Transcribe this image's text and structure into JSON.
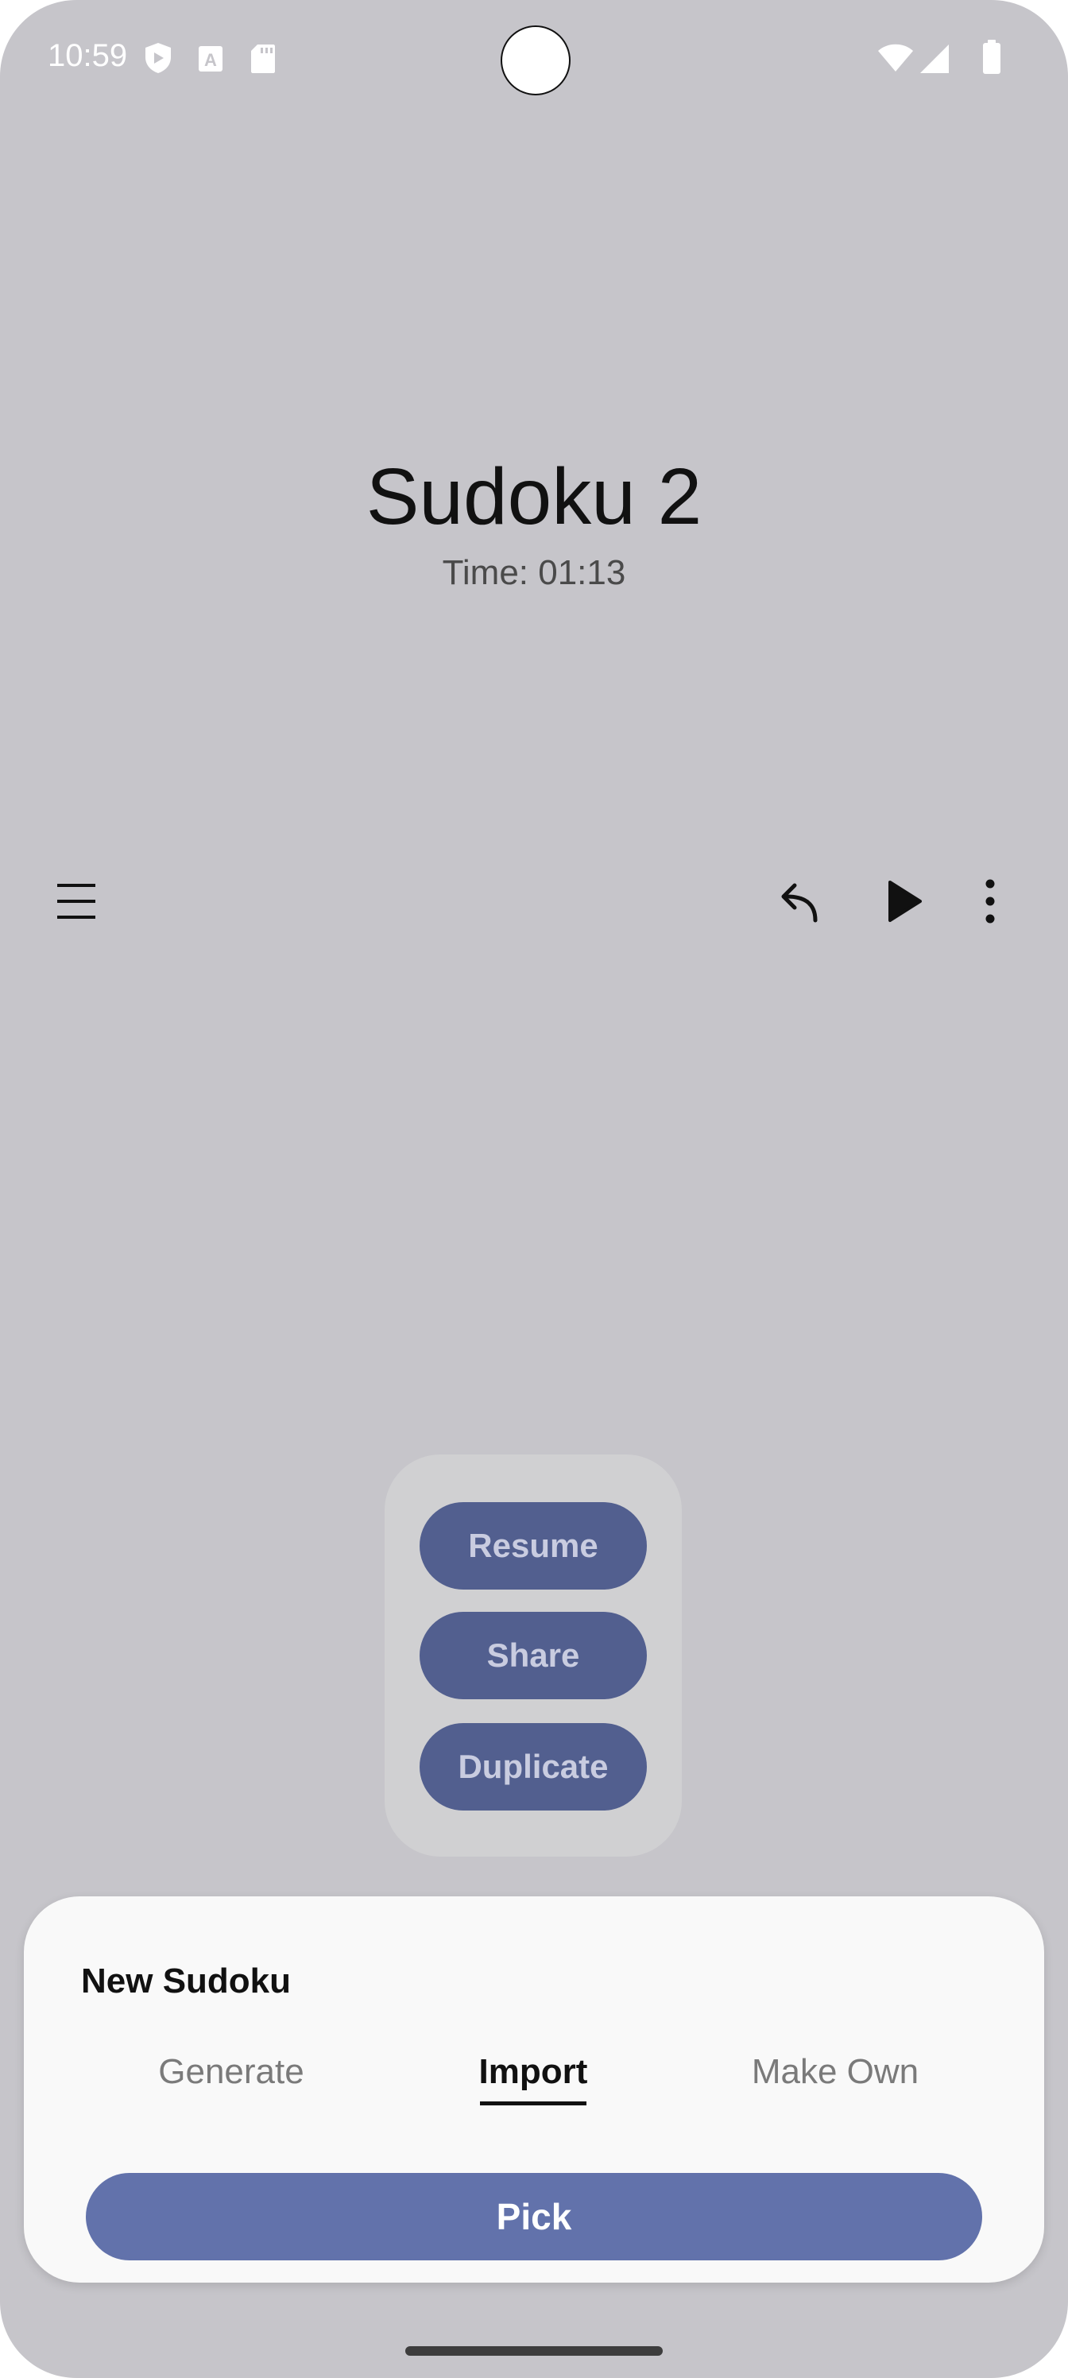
{
  "status_bar": {
    "time": "10:59",
    "icons": [
      "shield-icon",
      "font-a-icon",
      "sd-card-icon",
      "wifi-icon",
      "signal-icon",
      "battery-icon"
    ]
  },
  "header": {
    "title": "Sudoku 2",
    "timer": "Time: 01:13"
  },
  "toolbar": {
    "left_icon": "menu-icon",
    "right_icons": [
      "undo-icon",
      "play-icon",
      "more-vert-icon"
    ]
  },
  "popup_menu": {
    "items": [
      "Resume",
      "Share",
      "Duplicate"
    ],
    "button_color": "#525f8f"
  },
  "bottom_sheet": {
    "title": "New Sudoku",
    "tabs": [
      "Generate",
      "Import",
      "Make Own"
    ],
    "active_tab": "Import",
    "action_label": "Pick",
    "action_color": "#6272ab"
  }
}
